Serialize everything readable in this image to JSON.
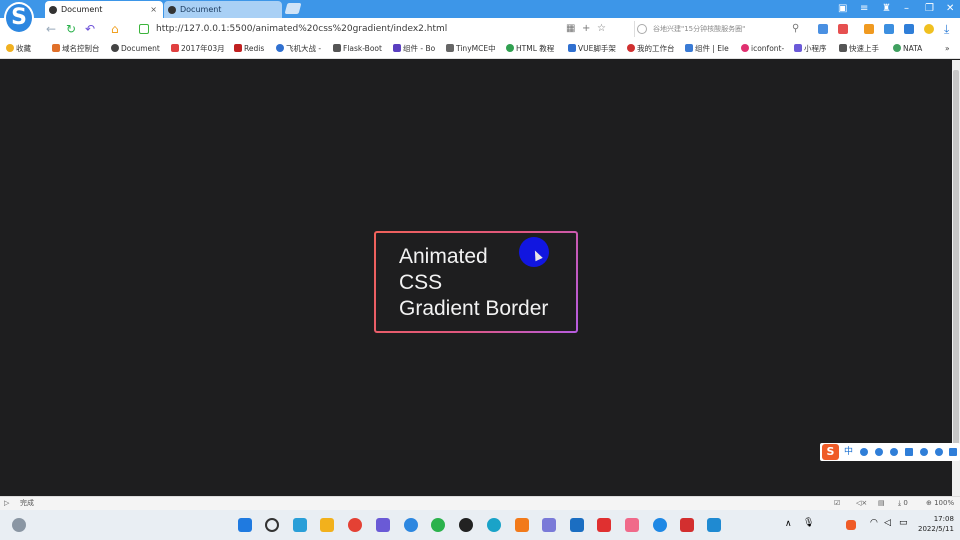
{
  "browser": {
    "tabs": [
      {
        "title": "Document",
        "active": true
      },
      {
        "title": "Document",
        "active": false
      }
    ],
    "url": "http://127.0.0.1:5500/animated%20css%20gradient/index2.html",
    "search_placeholder": "谷地兴建\"15分钟核酸服务圈\"",
    "bookmarks": [
      "收藏",
      "域名控制台",
      "Document",
      "2017年03月",
      "Redis",
      "飞机大战 -",
      "Flask-Boot",
      "组件 - Bo",
      "TinyMCE中",
      "HTML 教程",
      "VUE脚手架",
      "我的工作台",
      "组件 | Ele",
      "iconfont-",
      "小程序",
      "快速上手",
      "NATA"
    ],
    "status_left": "完成",
    "status_right": {
      "download": "0",
      "zoom": "100%"
    }
  },
  "page": {
    "card_lines": [
      "Animated",
      "CSS",
      "Gradient Border"
    ],
    "gradient_colors": [
      "#f0625a",
      "#e0577e",
      "#b65ce0"
    ],
    "cursor_color": "#1116e0"
  },
  "ime": {
    "label": "中"
  },
  "taskbar": {
    "time": "17:08",
    "date": "2022/5/11"
  }
}
